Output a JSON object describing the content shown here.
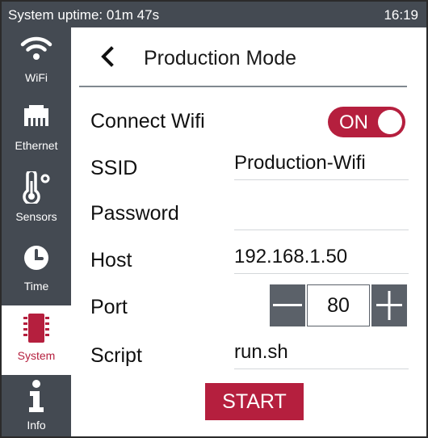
{
  "statusbar": {
    "uptime": "System uptime: 01m 47s",
    "clock": "16:19"
  },
  "sidebar": {
    "items": [
      {
        "label": "WiFi",
        "icon": "wifi-icon",
        "active": false
      },
      {
        "label": "Ethernet",
        "icon": "ethernet-icon",
        "active": false
      },
      {
        "label": "Sensors",
        "icon": "thermometer-icon",
        "active": false
      },
      {
        "label": "Time",
        "icon": "clock-icon",
        "active": false
      },
      {
        "label": "System",
        "icon": "chip-icon",
        "active": true
      },
      {
        "label": "Info",
        "icon": "info-icon",
        "active": false
      }
    ]
  },
  "header": {
    "title": "Production Mode",
    "back_icon": "chevron-left-icon"
  },
  "form": {
    "connect_wifi": {
      "label": "Connect Wifi",
      "toggle_text": "ON",
      "value": true
    },
    "ssid": {
      "label": "SSID",
      "value": "Production-Wifi"
    },
    "password": {
      "label": "Password",
      "value": ""
    },
    "host": {
      "label": "Host",
      "value": "192.168.1.50"
    },
    "port": {
      "label": "Port",
      "value": "80"
    },
    "script": {
      "label": "Script",
      "value": "run.sh"
    }
  },
  "actions": {
    "start_label": "START"
  },
  "colors": {
    "accent": "#b51f3e",
    "sidebar_bg": "#444a52",
    "stepper_bg": "#5b6169"
  }
}
